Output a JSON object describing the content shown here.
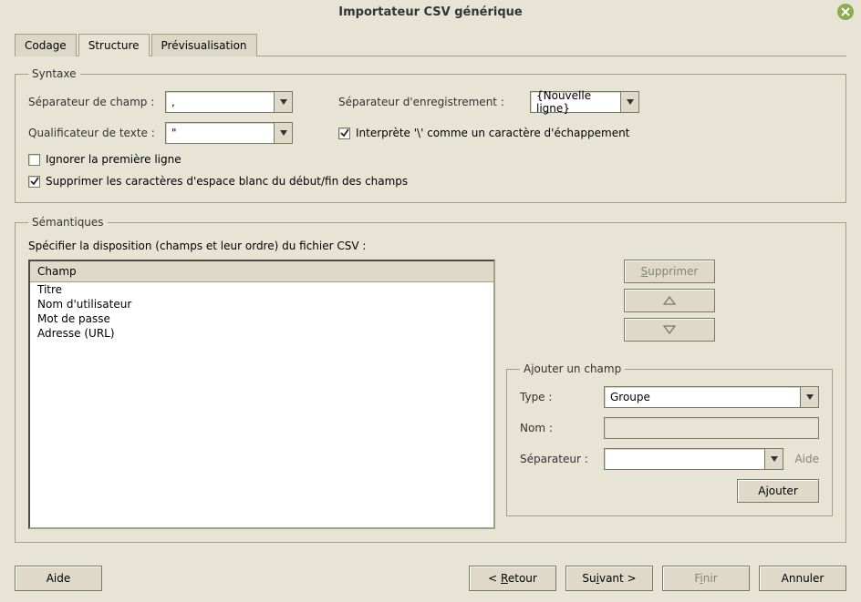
{
  "window": {
    "title": "Importateur CSV générique"
  },
  "tabs": {
    "codage": "Codage",
    "structure": "Structure",
    "previsualisation": "Prévisualisation"
  },
  "syntaxe": {
    "legend": "Syntaxe",
    "field_sep_label": "Séparateur de champ :",
    "field_sep_value": ",",
    "rec_sep_label": "Séparateur d'enregistrement :",
    "rec_sep_value": "{Nouvelle ligne}",
    "text_qual_label": "Qualificateur de texte :",
    "text_qual_value": "\"",
    "escape_label": "Interprète '\\' comme un caractère d'échappement",
    "escape_checked": true,
    "ignore_first_label": "Ignorer la première ligne",
    "ignore_first_checked": false,
    "trim_label": "Supprimer les caractères d'espace blanc du début/fin des champs",
    "trim_checked": true
  },
  "semantiques": {
    "legend": "Sémantiques",
    "specify_label": "Spécifier la disposition (champs et leur ordre) du fichier CSV :",
    "col_header": "Champ",
    "fields": [
      "Titre",
      "Nom d'utilisateur",
      "Mot de passe",
      "Adresse (URL)"
    ],
    "btn_supprimer": "upprimer",
    "btn_supprimer_prefix": "S",
    "addfield": {
      "legend": "Ajouter un champ",
      "type_label": "Type :",
      "type_value": "Groupe",
      "name_label": "Nom :",
      "name_value": "",
      "sep_label": "Séparateur :",
      "sep_value": "",
      "help": "Aide",
      "add_btn": "Ajouter"
    }
  },
  "footer": {
    "help": "Aide",
    "back_prefix": "< ",
    "back_u": "R",
    "back_suffix": "etour",
    "next_prefix": "Su",
    "next_u": "i",
    "next_suffix": "vant >",
    "finish_prefix": "F",
    "finish_u": "i",
    "finish_suffix": "nir",
    "cancel": "Annuler"
  }
}
